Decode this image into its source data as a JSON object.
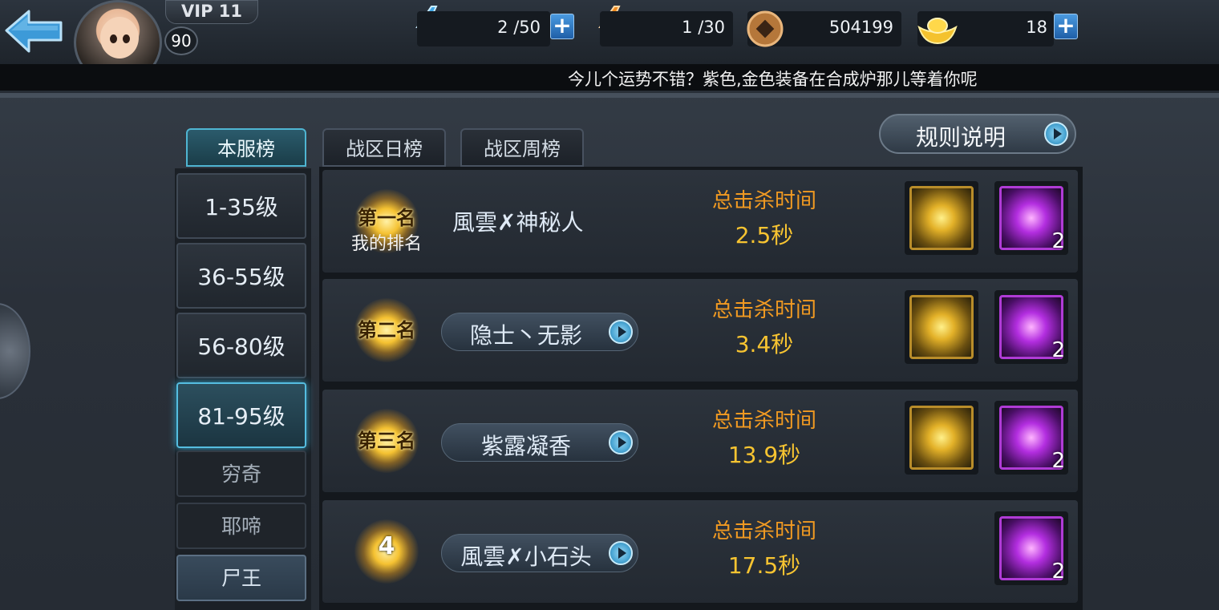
{
  "player": {
    "vip": "VIP 11",
    "level": "90"
  },
  "resources": {
    "stamina_char": "体",
    "stamina": "2 /50",
    "vigor_char": "活",
    "vigor": "1 /30",
    "coins": "504199",
    "ingots": "18",
    "plus": "+"
  },
  "ticker": "今儿个运势不错？紫色,金色装备在合成炉那儿等着你呢",
  "tabs": [
    {
      "label": "本服榜"
    },
    {
      "label": "战区日榜"
    },
    {
      "label": "战区周榜"
    }
  ],
  "rules_button": "规则说明",
  "sidebar": {
    "levels": [
      "1-35级",
      "36-55级",
      "56-80级",
      "81-95级"
    ],
    "bosses": [
      "穷奇",
      "耶啼",
      "尸王"
    ]
  },
  "ranking": [
    {
      "rank": "第一名",
      "sub": "我的排名",
      "name": "風雲✗神秘人",
      "label": "总击杀时间",
      "time": "2.5秒",
      "rewards": [
        {
          "type": "gold",
          "count": ""
        },
        {
          "type": "purple",
          "count": "2"
        }
      ]
    },
    {
      "rank": "第二名",
      "name": "隐士丶无影",
      "label": "总击杀时间",
      "time": "3.4秒",
      "rewards": [
        {
          "type": "gold",
          "count": ""
        },
        {
          "type": "purple",
          "count": "2"
        }
      ]
    },
    {
      "rank": "第三名",
      "name": "紫露凝香",
      "label": "总击杀时间",
      "time": "13.9秒",
      "rewards": [
        {
          "type": "gold",
          "count": ""
        },
        {
          "type": "purple",
          "count": "2"
        }
      ]
    },
    {
      "rank": "4",
      "name": "風雲✗小石头",
      "label": "总击杀时间",
      "time": "17.5秒",
      "rewards": [
        {
          "type": "purple",
          "count": "2"
        }
      ]
    }
  ],
  "colors": {
    "accent": "#4fb5d2",
    "gold_text": "#f7c431",
    "orange_text": "#f19a22"
  }
}
